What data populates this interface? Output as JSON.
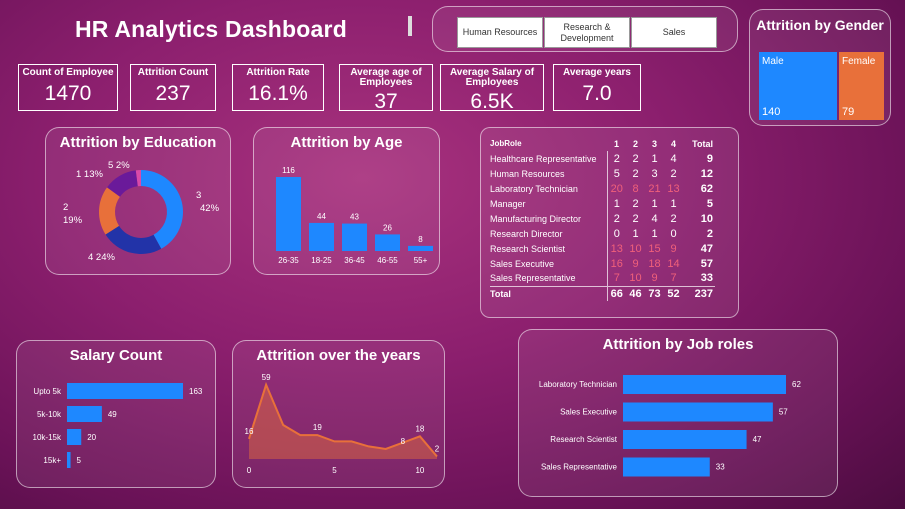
{
  "header": {
    "title": "HR Analytics Dashboard"
  },
  "slicer": {
    "options": [
      "Human Resources",
      "Research & Development",
      "Sales"
    ]
  },
  "kpis": [
    {
      "label": "Count of Employee",
      "value": "1470"
    },
    {
      "label": "Attrition Count",
      "value": "237"
    },
    {
      "label": "Attrition Rate",
      "value": "16.1%"
    },
    {
      "label": "Average age of Employees",
      "value": "37"
    },
    {
      "label": "Average Salary of Employees",
      "value": "6.5K"
    },
    {
      "label": "Average years",
      "value": "7.0"
    }
  ],
  "gender": {
    "title": "Attrition by Gender",
    "male_label": "Male",
    "male_value": "140",
    "female_label": "Female",
    "female_value": "79",
    "colors": {
      "male": "#1e88ff",
      "female": "#e8703a"
    }
  },
  "education": {
    "title": "Attrition by Education"
  },
  "age": {
    "title": "Attrition by Age"
  },
  "salary": {
    "title": "Salary Count"
  },
  "years": {
    "title": "Attrition over the years"
  },
  "jobroles": {
    "title": "Attrition by Job roles"
  },
  "table": {
    "headers": [
      "JobRole",
      "1",
      "2",
      "3",
      "4",
      "Total"
    ],
    "rows": [
      {
        "role": "Healthcare Representative",
        "v": [
          "2",
          "2",
          "1",
          "4"
        ],
        "total": "9",
        "hi": false
      },
      {
        "role": "Human Resources",
        "v": [
          "5",
          "2",
          "3",
          "2"
        ],
        "total": "12",
        "hi": false
      },
      {
        "role": "Laboratory Technician",
        "v": [
          "20",
          "8",
          "21",
          "13"
        ],
        "total": "62",
        "hi": true
      },
      {
        "role": "Manager",
        "v": [
          "1",
          "2",
          "1",
          "1"
        ],
        "total": "5",
        "hi": false
      },
      {
        "role": "Manufacturing Director",
        "v": [
          "2",
          "2",
          "4",
          "2"
        ],
        "total": "10",
        "hi": false
      },
      {
        "role": "Research Director",
        "v": [
          "0",
          "1",
          "1",
          "0"
        ],
        "total": "2",
        "hi": false
      },
      {
        "role": "Research Scientist",
        "v": [
          "13",
          "10",
          "15",
          "9"
        ],
        "total": "47",
        "hi": true
      },
      {
        "role": "Sales Executive",
        "v": [
          "16",
          "9",
          "18",
          "14"
        ],
        "total": "57",
        "hi": true
      },
      {
        "role": "Sales Representative",
        "v": [
          "7",
          "10",
          "9",
          "7"
        ],
        "total": "33",
        "hi": true
      }
    ],
    "total_label": "Total",
    "totals": [
      "66",
      "46",
      "73",
      "52",
      "237"
    ]
  },
  "chart_data": [
    {
      "type": "pie",
      "title": "Attrition by Education",
      "categories": [
        "1",
        "2",
        "3",
        "4",
        "5"
      ],
      "values": [
        13,
        19,
        42,
        24,
        2
      ],
      "labels": [
        "1 13%",
        "2 19%",
        "3 42%",
        "4 24%",
        "5 2%"
      ],
      "colors": [
        "#6a1a9a",
        "#e8703a",
        "#1e88ff",
        "#2233a8",
        "#d84aa8"
      ]
    },
    {
      "type": "bar",
      "title": "Attrition by Age",
      "categories": [
        "26-35",
        "18-25",
        "36-45",
        "46-55",
        "55+"
      ],
      "values": [
        116,
        44,
        43,
        26,
        8
      ],
      "ylim": [
        0,
        116
      ]
    },
    {
      "type": "bar",
      "title": "Salary Count",
      "orientation": "horizontal",
      "categories": [
        "Upto 5k",
        "5k-10k",
        "10k-15k",
        "15k+"
      ],
      "values": [
        163,
        49,
        20,
        5
      ]
    },
    {
      "type": "area",
      "title": "Attrition over the years",
      "x": [
        0,
        1,
        2,
        3,
        4,
        5,
        6,
        7,
        8,
        9,
        10,
        11
      ],
      "values": [
        16,
        59,
        27,
        19,
        19,
        14,
        14,
        10,
        8,
        13,
        18,
        2
      ],
      "labeled_points": [
        [
          0,
          16
        ],
        [
          1,
          59
        ],
        [
          4,
          19
        ],
        [
          9,
          8
        ],
        [
          10,
          18
        ],
        [
          11,
          2
        ]
      ],
      "xticks": [
        0,
        5,
        10
      ],
      "xlim": [
        0,
        11
      ]
    },
    {
      "type": "bar",
      "title": "Attrition by Job roles",
      "orientation": "horizontal",
      "categories": [
        "Laboratory Technician",
        "Sales Executive",
        "Research Scientist",
        "Sales Representative"
      ],
      "values": [
        62,
        57,
        47,
        33
      ]
    }
  ]
}
